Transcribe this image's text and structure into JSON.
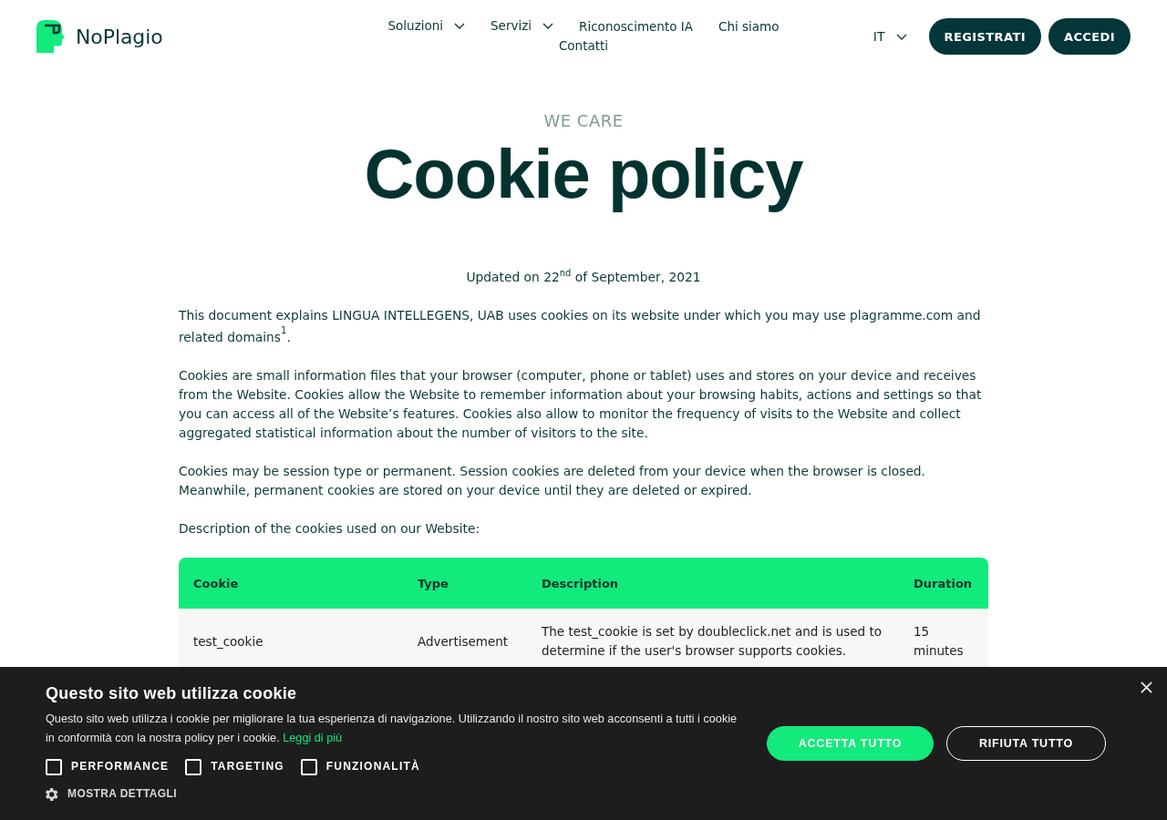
{
  "header": {
    "logo": {
      "text": "NoPlagio"
    },
    "nav": [
      {
        "label": "Soluzioni",
        "dropdown": true
      },
      {
        "label": "Servizi",
        "dropdown": true
      },
      {
        "label": "Riconoscimento IA",
        "dropdown": false
      },
      {
        "label": "Chi siamo",
        "dropdown": false
      },
      {
        "label": "Contatti",
        "dropdown": false
      }
    ],
    "language": {
      "label": "IT",
      "dropdown": true
    },
    "buttons": [
      "REGISTRATI",
      "ACCEDI"
    ]
  },
  "hero": {
    "eyebrow": "WE CARE",
    "title": "Cookie policy"
  },
  "updated": "Updated on 22$^{nd}$ of September, 2021",
  "paragraphs": [
    "This document explains LINGUA INTELLEGENS, UAB uses cookies on its website under which you may use plagramme.com and related domains$^{1}$.",
    "Cookies are small information files that your browser (computer, phone or tablet) uses and stores on your device and receives from the Website. Cookies allow the Website to remember information about your browsing habits, actions and settings so that you can access all of the Website’s features. Cookies also allow to monitor the frequency of visits to the Website and collect aggregated statistical information about the number of visitors to the site.",
    "Cookies may be session type or permanent. Session cookies are deleted from your device when the browser is closed. Meanwhile, permanent cookies are stored on your device until they are deleted or expired.",
    "Description of the cookies used on our Website:"
  ],
  "table": {
    "columns": [
      "Cookie",
      "Type",
      "Description",
      "Duration"
    ],
    "rows": [
      [
        "test_cookie",
        "Advertisement",
        "The test_cookie is set by doubleclick.net and is used to determine if the user's browser supports cookies.",
        "15 minutes"
      ]
    ]
  },
  "cookie_banner": {
    "title": "Questo sito web utilizza cookie",
    "text": "Questo sito web utilizza i cookie per migliorare la tua esperienza di navigazione. Utilizzando il nostro sito web acconsenti a tutti i cookie in conformità con la nostra policy per i cookie.",
    "link": "Leggi di più",
    "checkboxes": [
      {
        "label": "PERFORMANCE",
        "checked": false
      },
      {
        "label": "TARGETING",
        "checked": false
      },
      {
        "label": "FUNZIONALITÀ",
        "checked": false
      }
    ],
    "details_label": "MOSTRA DETTAGLI",
    "buttons": [
      {
        "label": "ACCETTA TUTTO",
        "kind": "primary"
      },
      {
        "label": "RIFIUTA TUTTO",
        "kind": "outline"
      }
    ]
  }
}
